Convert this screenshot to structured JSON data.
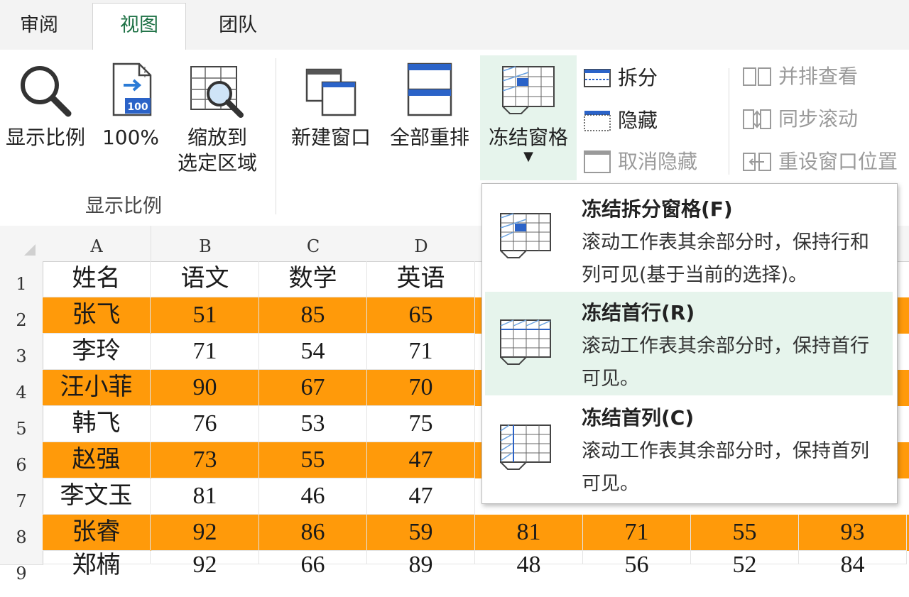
{
  "tabs": [
    {
      "label": "审阅"
    },
    {
      "label": "视图"
    },
    {
      "label": "团队"
    }
  ],
  "ribbon": {
    "zoom_group": {
      "label": "显示比例",
      "zoom_button": "显示比例",
      "hundred_button": "100%",
      "hundred_badge": "100",
      "zoom_selection_line1": "缩放到",
      "zoom_selection_line2": "选定区域"
    },
    "window_group": {
      "new_window": "新建窗口",
      "arrange_all": "全部重排",
      "freeze_panes": "冻结窗格",
      "split": "拆分",
      "hide": "隐藏",
      "unhide": "取消隐藏",
      "side_by_side": "并排查看",
      "sync_scroll": "同步滚动",
      "reset_position": "重设窗口位置"
    }
  },
  "sheet": {
    "columns": [
      "A",
      "B",
      "C",
      "D"
    ],
    "rows": [
      {
        "num": "1",
        "cells": [
          "姓名",
          "语文",
          "数学",
          "英语"
        ],
        "extra": [],
        "highlight": false
      },
      {
        "num": "2",
        "cells": [
          "张飞",
          "51",
          "85",
          "65"
        ],
        "extra": [],
        "highlight": true
      },
      {
        "num": "3",
        "cells": [
          "李玲",
          "71",
          "54",
          "71"
        ],
        "extra": [],
        "highlight": false
      },
      {
        "num": "4",
        "cells": [
          "汪小菲",
          "90",
          "67",
          "70"
        ],
        "extra": [],
        "highlight": true
      },
      {
        "num": "5",
        "cells": [
          "韩飞",
          "76",
          "53",
          "75"
        ],
        "extra": [],
        "highlight": false
      },
      {
        "num": "6",
        "cells": [
          "赵强",
          "73",
          "55",
          "47"
        ],
        "extra": [],
        "highlight": true
      },
      {
        "num": "7",
        "cells": [
          "李文玉",
          "81",
          "46",
          "47"
        ],
        "extra": [],
        "highlight": false
      },
      {
        "num": "8",
        "cells": [
          "张睿",
          "92",
          "86",
          "59"
        ],
        "extra": [
          "81",
          "71",
          "55",
          "93"
        ],
        "highlight": true
      },
      {
        "num": "9",
        "cells": [
          "郑楠",
          "92",
          "66",
          "89"
        ],
        "extra": [
          "48",
          "56",
          "52",
          "84"
        ],
        "highlight": false
      }
    ],
    "highlight_color": "#ff9a0a"
  },
  "dropdown": {
    "items": [
      {
        "title": "冻结拆分窗格(F)",
        "desc": "滚动工作表其余部分时，保持行和列可见(基于当前的选择)。"
      },
      {
        "title": "冻结首行(R)",
        "desc": "滚动工作表其余部分时，保持首行可见。"
      },
      {
        "title": "冻结首列(C)",
        "desc": "滚动工作表其余部分时，保持首列可见。"
      }
    ]
  },
  "colors": {
    "accent_green": "#1e7145",
    "hover_green": "#e6f4ec",
    "icon_blue": "#2b63c8"
  }
}
